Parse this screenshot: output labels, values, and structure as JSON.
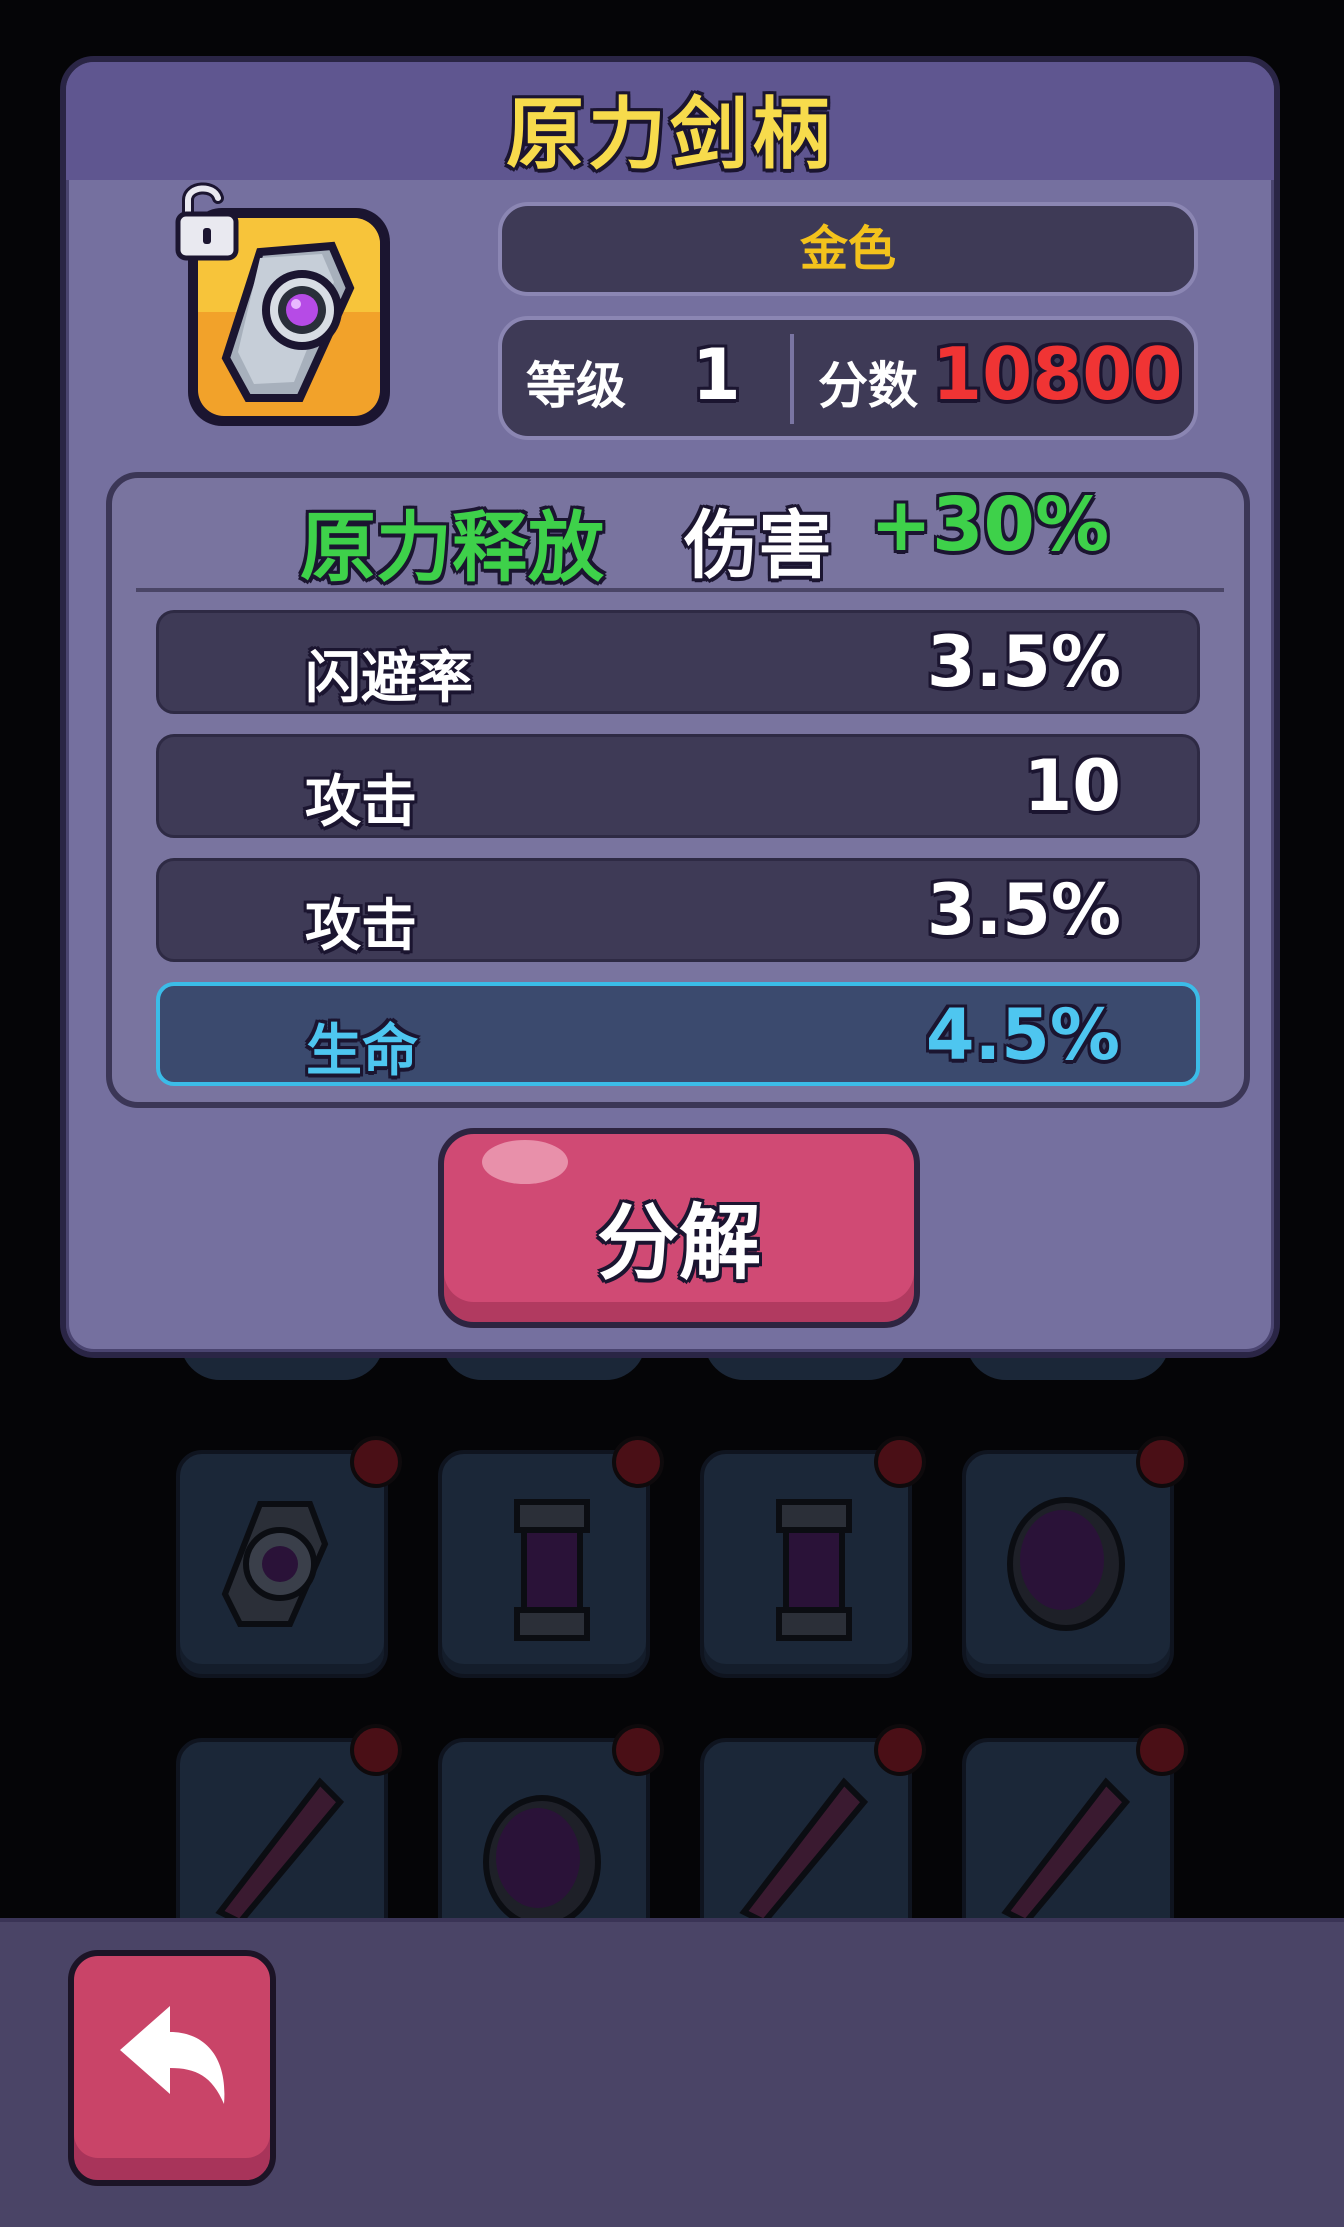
{
  "item": {
    "name": "原力剑柄",
    "rarity": "金色",
    "level_label": "等级",
    "level": "1",
    "score_label": "分数",
    "score": "10800",
    "icon": "force-hilt-icon",
    "lock_icon": "unlocked-padlock-icon"
  },
  "set_bonus": {
    "name": "原力释放",
    "effect_label": "伤害",
    "effect_value": "+30%"
  },
  "attributes": [
    {
      "label": "闪避率",
      "value": "3.5%"
    },
    {
      "label": "攻击",
      "value": "10"
    },
    {
      "label": "攻击",
      "value": "3.5%"
    },
    {
      "label": "生命",
      "value": "4.5%"
    }
  ],
  "actions": {
    "decompose_label": "分解",
    "back_icon": "back-arrow-icon"
  },
  "colors": {
    "rarity_gold": "#f3c21c",
    "score_red": "#f03434",
    "set_green": "#3ed14a",
    "highlight_cyan": "#4ec6f0"
  }
}
